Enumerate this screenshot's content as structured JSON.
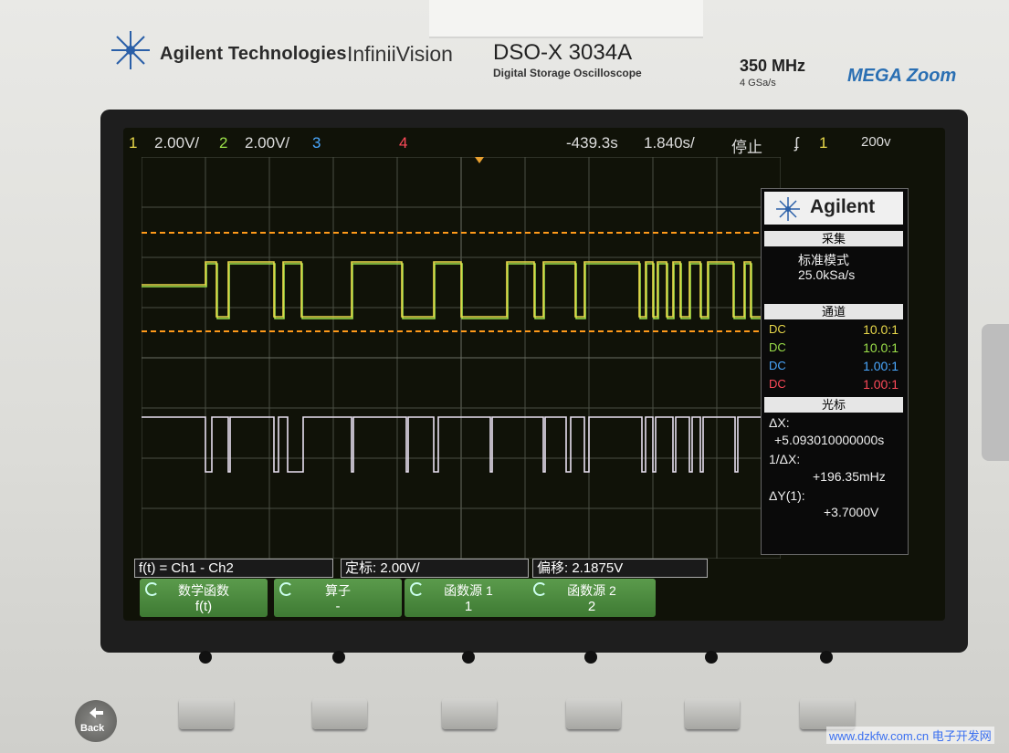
{
  "brand": {
    "company": "Agilent Technologies",
    "series": "InfiniiVision",
    "model": "DSO-X 3034A",
    "model_desc": "Digital Storage Oscilloscope",
    "bandwidth": "350 MHz",
    "sample_rate": "4 GSa/s",
    "zoom_badge": "MEGA Zoom"
  },
  "status": {
    "ch1_num": "1",
    "ch1_scale": "2.00V/",
    "ch2_num": "2",
    "ch2_scale": "2.00V/",
    "ch3_num": "3",
    "ch4_num": "4",
    "delay": "-439.3s",
    "timebase": "1.840s/",
    "run_state": "停止",
    "trigger_icon": "ʄ",
    "trigger_source": "1",
    "trigger_level": "200v"
  },
  "side_panel": {
    "logo_text": "Agilent",
    "acq_title": "采集",
    "acq_mode": "标准模式",
    "acq_rate": "25.0kSa/s",
    "channels_title": "通道",
    "channels": [
      {
        "coupling": "DC",
        "ratio": "10.0:1",
        "color": "#e8d84a"
      },
      {
        "coupling": "DC",
        "ratio": "10.0:1",
        "color": "#9ce04a"
      },
      {
        "coupling": "DC",
        "ratio": "1.00:1",
        "color": "#4aa8ff"
      },
      {
        "coupling": "DC",
        "ratio": "1.00:1",
        "color": "#ff4a5a"
      }
    ],
    "cursor_title": "光标",
    "dx_label": "ΔX:",
    "dx_value": "+5.093010000000s",
    "inv_dx_label": "1/ΔX:",
    "inv_dx_value": "+196.35mHz",
    "dy_label": "ΔY(1):",
    "dy_value": "+3.7000V"
  },
  "function_bar": {
    "expr": "f(t) = Ch1 - Ch2",
    "scale": "定标: 2.00V/",
    "offset": "偏移: 2.1875V"
  },
  "softkeys": [
    {
      "label": "数学函数",
      "value": "f(t)"
    },
    {
      "label": "算子",
      "value": "-"
    },
    {
      "label": "函数源 1",
      "value": "1"
    },
    {
      "label": "函数源 2",
      "value": "2"
    }
  ],
  "hardware": {
    "back_label": "Back",
    "watermark": "www.dzkfw.com.cn 电子开发网"
  },
  "colors": {
    "ch1": "#e8d84a",
    "ch2": "#9ce04a",
    "math": "#e8e0f0",
    "cursor": "#ff9a1a"
  }
}
